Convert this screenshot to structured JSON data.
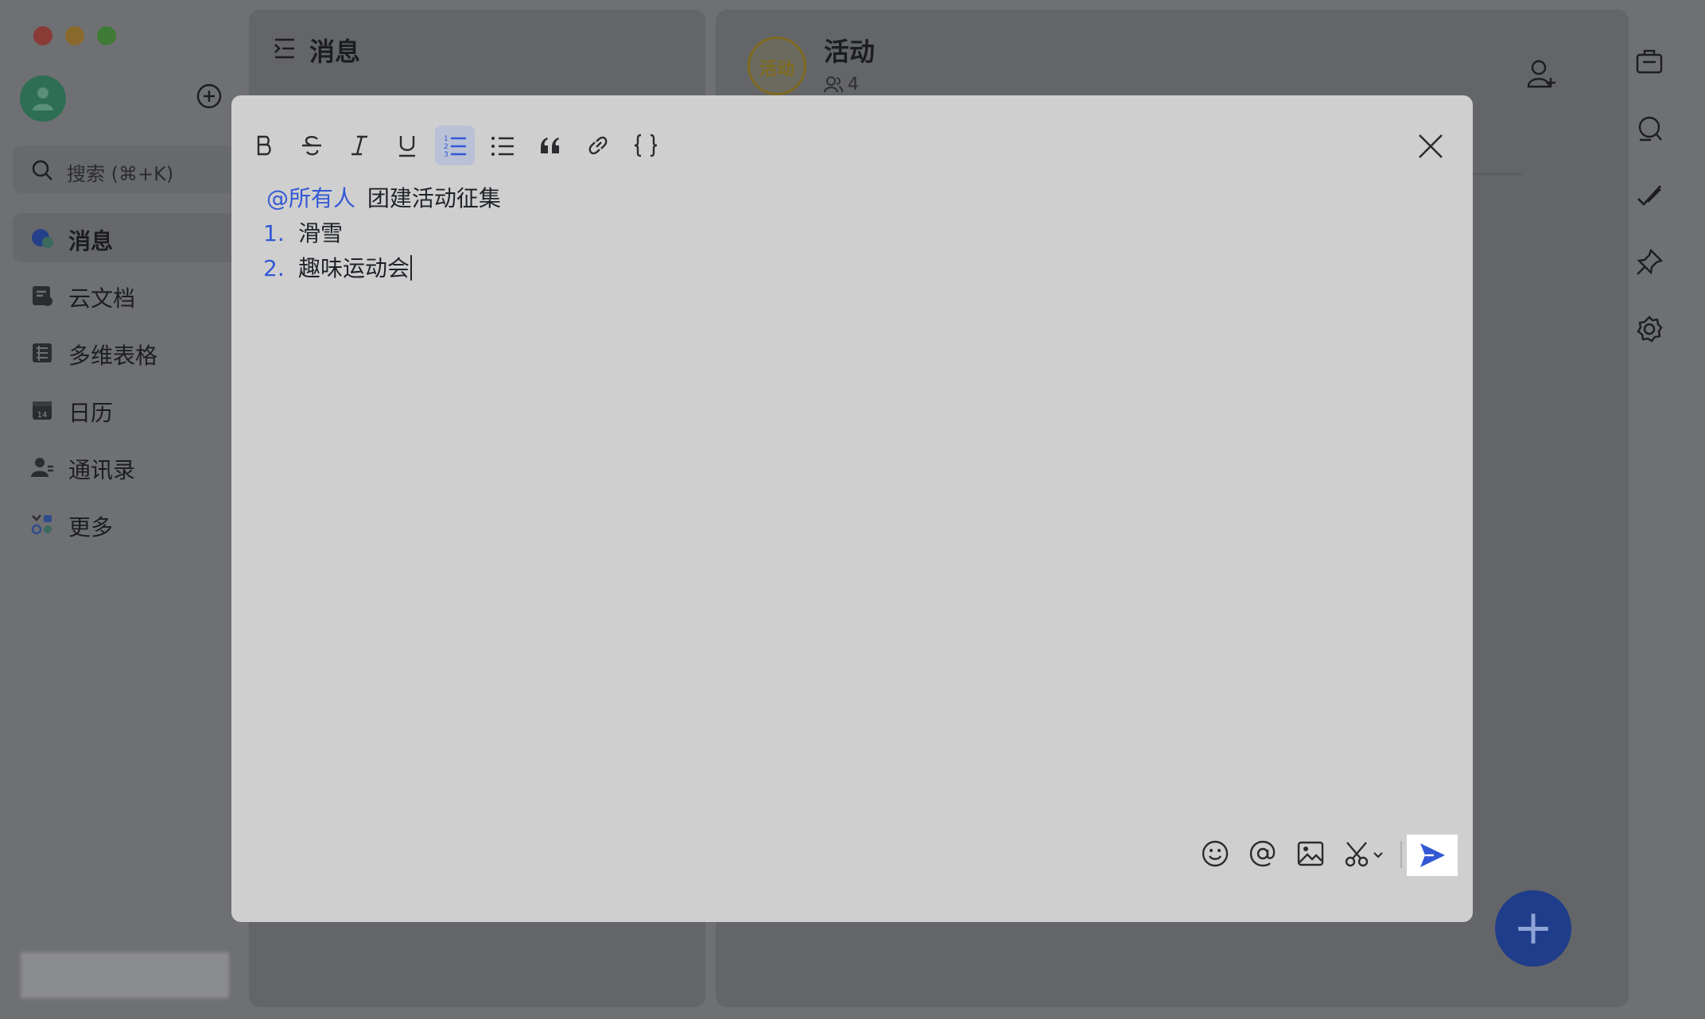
{
  "sidebar": {
    "search_placeholder": "搜索 (⌘+K)",
    "items": [
      {
        "label": "消息",
        "active": true
      },
      {
        "label": "云文档"
      },
      {
        "label": "多维表格"
      },
      {
        "label": "日历",
        "icon_text": "14"
      },
      {
        "label": "通讯录"
      },
      {
        "label": "更多"
      }
    ]
  },
  "list_panel": {
    "title": "消息"
  },
  "chat": {
    "avatar_text": "活动",
    "title": "活动",
    "member_count": "4"
  },
  "editor": {
    "mention": "@所有人",
    "heading": "团建活动征集",
    "list": [
      {
        "num": "1.",
        "text": "滑雪"
      },
      {
        "num": "2.",
        "text": "趣味运动会"
      }
    ]
  },
  "colors": {
    "accent": "#3358d4",
    "active_toolbar": "#b9c1d6",
    "dialog_bg": "#cfcfcf"
  },
  "icons": {
    "toolbar": [
      "bold-icon",
      "strikethrough-icon",
      "italic-icon",
      "underline-icon",
      "ordered-list-icon",
      "bullet-list-icon",
      "quote-icon",
      "link-icon",
      "code-block-icon"
    ],
    "bottom": [
      "emoji-icon",
      "mention-icon",
      "image-icon",
      "screenshot-icon"
    ]
  }
}
